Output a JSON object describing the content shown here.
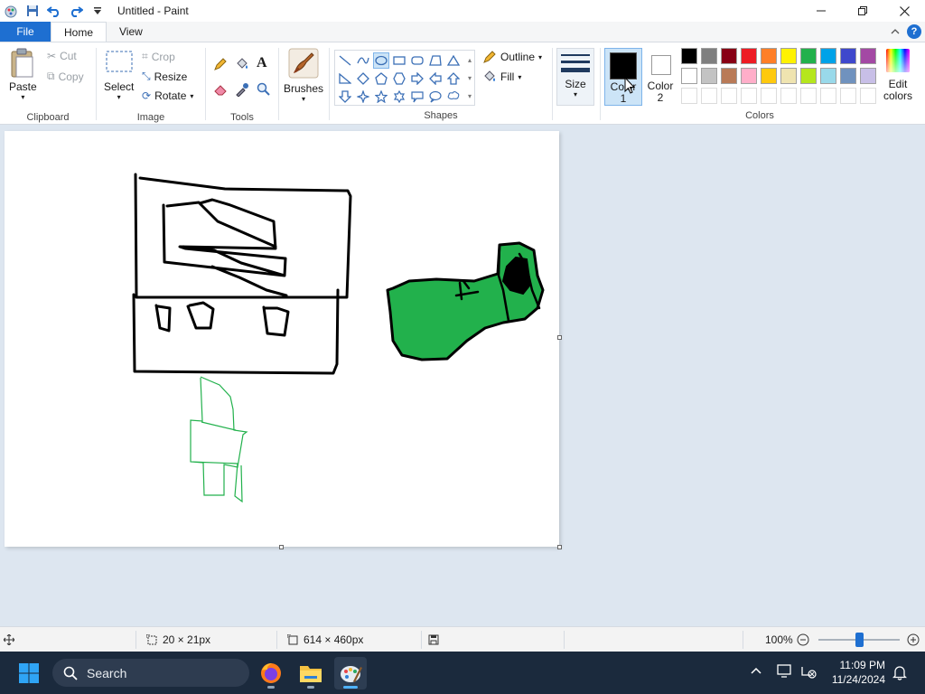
{
  "window": {
    "title": "Untitled - Paint"
  },
  "tabs": [
    {
      "label": "File"
    },
    {
      "label": "Home"
    },
    {
      "label": "View"
    }
  ],
  "ribbon": {
    "clipboard": {
      "group_label": "Clipboard",
      "paste": "Paste",
      "cut": "Cut",
      "copy": "Copy"
    },
    "image": {
      "group_label": "Image",
      "select": "Select",
      "crop": "Crop",
      "resize": "Resize",
      "rotate": "Rotate"
    },
    "tools": {
      "group_label": "Tools"
    },
    "brushes": {
      "label": "Brushes"
    },
    "shapes": {
      "group_label": "Shapes",
      "outline": "Outline",
      "fill": "Fill"
    },
    "size": {
      "label": "Size"
    },
    "colors": {
      "group_label": "Colors",
      "color1_label": "Color",
      "color1_num": "1",
      "color2_label": "Color",
      "color2_num": "2",
      "edit_colors_line1": "Edit",
      "edit_colors_line2": "colors",
      "color1_value": "#000000",
      "color2_value": "#ffffff",
      "palette_row1": [
        "#000000",
        "#7f7f7f",
        "#880015",
        "#ed1c24",
        "#ff7f27",
        "#fff200",
        "#22b14c",
        "#00a2e8",
        "#3f48cc",
        "#a349a4"
      ],
      "palette_row2": [
        "#ffffff",
        "#c3c3c3",
        "#b97a57",
        "#ffaec9",
        "#ffc90e",
        "#efe4b0",
        "#b5e61d",
        "#99d9ea",
        "#7092be",
        "#c8bfe7"
      ]
    }
  },
  "status": {
    "selection_size": "20 × 21px",
    "canvas_size": "614 × 460px",
    "zoom": "100%",
    "zoom_level_fraction": 0.5
  },
  "taskbar": {
    "search_placeholder": "Search",
    "time": "11:09 PM",
    "date": "11/24/2024"
  },
  "drawing_colors": {
    "stroke": "#000000",
    "fill_green": "#22b14c",
    "thin_green": "#22b14c"
  }
}
